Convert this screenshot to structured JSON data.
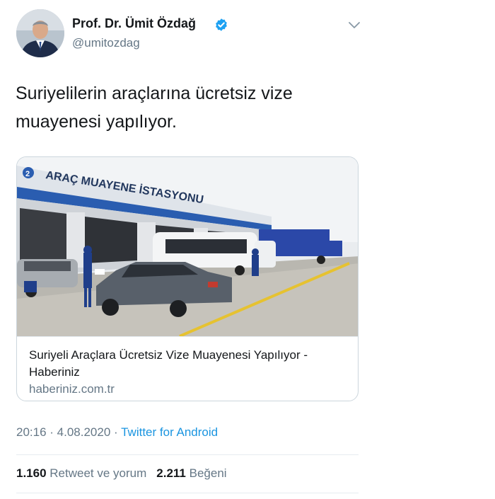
{
  "author": {
    "name": "Prof. Dr. Ümit Özdağ",
    "handle": "@umitozdag",
    "verified": true
  },
  "tweet": {
    "text": "Suriyelilerin araçlarına ücretsiz vize muayenesi yapılıyor."
  },
  "card": {
    "image_sign_text": "ARAÇ MUAYENE İSTASYONU",
    "image_bay_number": "2",
    "title": "Suriyeli Araçlara Ücretsiz Vize Muayenesi Yapılıyor - Haberiniz",
    "domain": "haberiniz.com.tr"
  },
  "meta": {
    "time": "20:16",
    "separator": " · ",
    "date": "4.08.2020",
    "source": "Twitter for Android"
  },
  "stats": {
    "retweets_count": "1.160",
    "retweets_label": "Retweet ve yorum",
    "likes_count": "2.211",
    "likes_label": "Beğeni"
  },
  "colors": {
    "link_blue": "#1b95e0",
    "secondary_text": "#657786",
    "verified_blue": "#1da1f2"
  },
  "icons": {
    "verified": "verified-badge-icon",
    "caret": "chevron-down-icon"
  }
}
